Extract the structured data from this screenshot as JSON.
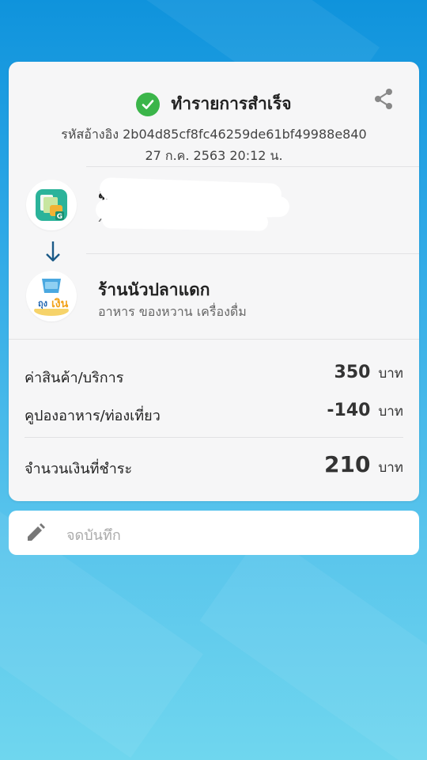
{
  "header": {
    "status_text": "ทำรายการสำเร็จ",
    "reference": "รหัสอ้างอิง  2b04d85cf8fc46259de61bf49988e840",
    "datetime": "27 ก.ค. 2563  20:12 น."
  },
  "sender": {
    "name": "ชิดา",
    "account": "x-xxxx-xxxx-03",
    "icon": "g-wallet-app-icon"
  },
  "merchant": {
    "name": "ร้านนัวปลาแดก",
    "category": "อาหาร ของหวาน เครื่องดื่ม",
    "icon": "tung-ngern-logo"
  },
  "summary": {
    "rows": [
      {
        "label": "ค่าสินค้า/บริการ",
        "amount": "350",
        "unit": "บาท"
      },
      {
        "label": "คูปองอาหาร/ท่องเที่ยว",
        "amount": "-140",
        "unit": "บาท"
      }
    ],
    "total": {
      "label": "จำนวนเงินที่ชำระ",
      "amount": "210",
      "unit": "บาท"
    }
  },
  "note": {
    "placeholder": "จดบันทึก"
  },
  "colors": {
    "success": "#3bb54a",
    "background_top": "#0f93dc",
    "background_bottom": "#6fd6ee"
  }
}
